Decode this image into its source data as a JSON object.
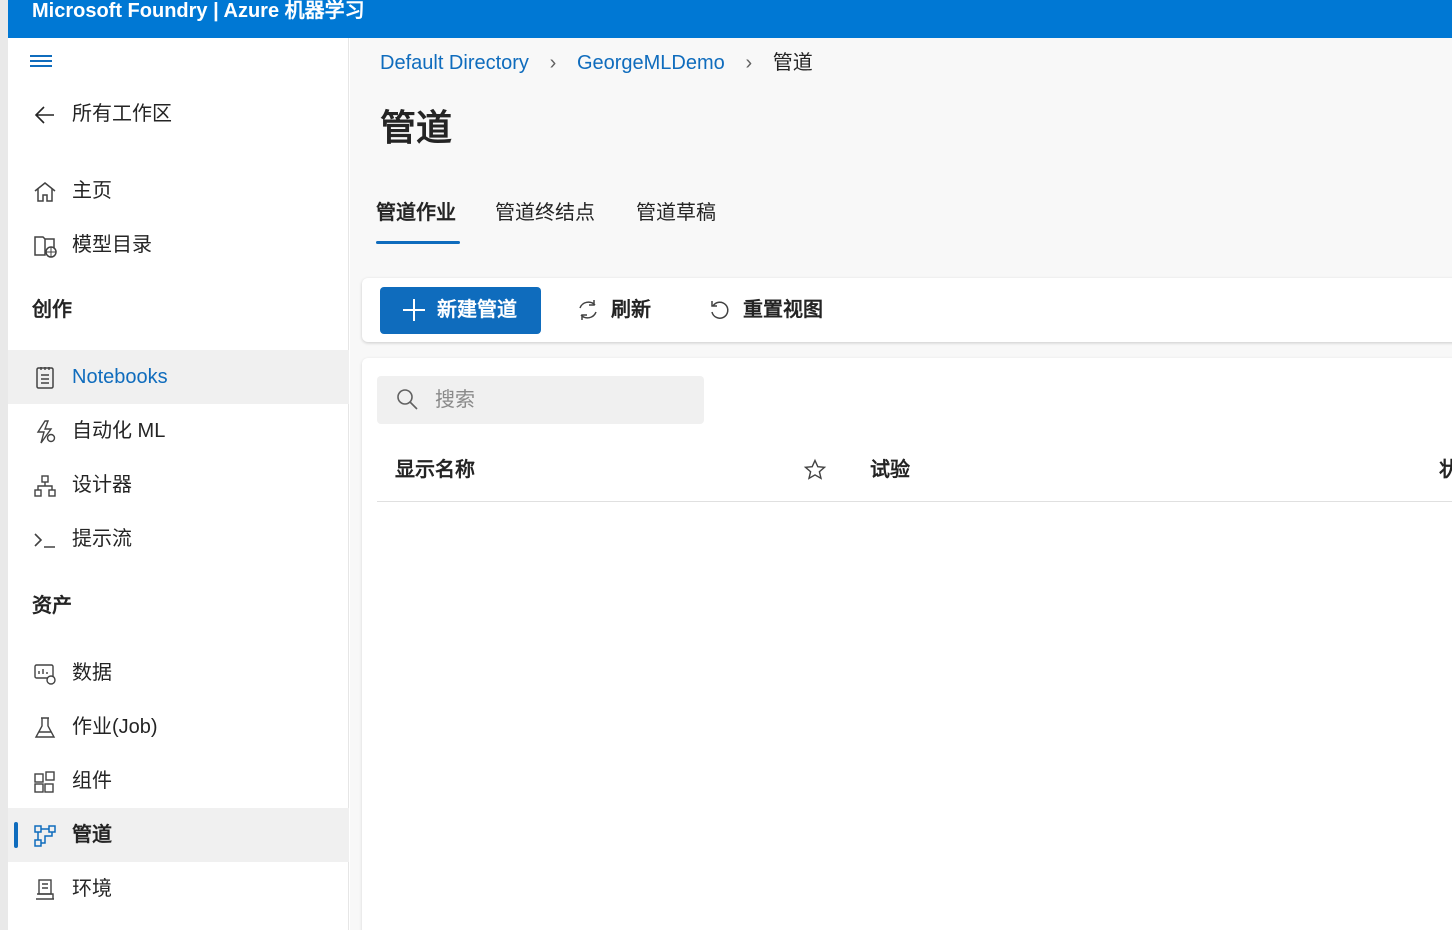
{
  "app": {
    "title": "Microsoft Foundry | Azure 机器学习"
  },
  "sidebar": {
    "back_label": "所有工作区",
    "top_items": [
      {
        "label": "主页",
        "icon": "home-icon"
      },
      {
        "label": "模型目录",
        "icon": "model-catalog-icon"
      }
    ],
    "authoring_heading": "创作",
    "authoring_items": [
      {
        "label": "Notebooks",
        "icon": "notebook-icon"
      },
      {
        "label": "自动化 ML",
        "icon": "automl-icon"
      },
      {
        "label": "设计器",
        "icon": "designer-icon"
      },
      {
        "label": "提示流",
        "icon": "prompt-flow-icon"
      }
    ],
    "assets_heading": "资产",
    "assets_items": [
      {
        "label": "数据",
        "icon": "data-icon"
      },
      {
        "label": "作业(Job)",
        "icon": "flask-icon"
      },
      {
        "label": "组件",
        "icon": "components-icon"
      },
      {
        "label": "管道",
        "icon": "pipeline-icon",
        "active": true
      },
      {
        "label": "环境",
        "icon": "environment-icon"
      }
    ]
  },
  "breadcrumb": {
    "items": [
      "Default Directory",
      "GeorgeMLDemo",
      "管道"
    ]
  },
  "page": {
    "title": "管道"
  },
  "tabs": [
    "管道作业",
    "管道终结点",
    "管道草稿"
  ],
  "toolbar": {
    "new_label": "新建管道",
    "refresh_label": "刷新",
    "reset_label": "重置视图"
  },
  "search": {
    "placeholder": "搜索",
    "value": ""
  },
  "table": {
    "columns": [
      "显示名称",
      "试验",
      "状"
    ]
  },
  "colors": {
    "accent": "#0078d4",
    "primary_button": "#0f6cbd",
    "link": "#0f6cbd"
  }
}
